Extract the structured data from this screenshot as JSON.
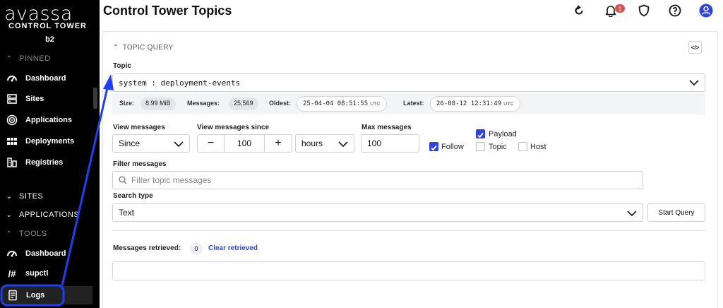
{
  "sidebar": {
    "logo": "avassa",
    "subtitle": "CONTROL TOWER",
    "instance": "b2",
    "pinned_label": "PINNED",
    "pinned_items": [
      {
        "label": "Dashboard",
        "icon": "dashboard-icon"
      },
      {
        "label": "Sites",
        "icon": "server-icon"
      },
      {
        "label": "Applications",
        "icon": "applications-icon"
      },
      {
        "label": "Deployments",
        "icon": "deployments-icon"
      },
      {
        "label": "Registries",
        "icon": "registries-icon"
      }
    ],
    "sections": {
      "sites": "SITES",
      "applications": "APPLICATIONS",
      "tools": "TOOLS"
    },
    "tool_items": [
      {
        "label": "Dashboard",
        "icon": "dashboard-icon"
      },
      {
        "label": "supctl",
        "icon": "terminal-icon"
      },
      {
        "label": "Logs",
        "icon": "logs-icon",
        "active": true
      }
    ]
  },
  "header": {
    "title": "Control Tower Topics",
    "notification_count": "1",
    "icons": [
      "refresh-icon",
      "bell-icon",
      "shield-icon",
      "help-icon",
      "user-icon"
    ]
  },
  "query": {
    "section_label": "TOPIC QUERY",
    "code_button": "</>",
    "topic_label": "Topic",
    "topic_value": "system : deployment-events",
    "stats": {
      "size_label": "Size:",
      "size_value": "8.99 MiB",
      "messages_label": "Messages:",
      "messages_value": "25,569",
      "oldest_label": "Oldest:",
      "oldest_value": "25-04-04 08:51:55",
      "oldest_tz": "UTC",
      "latest_label": "Latest:",
      "latest_value": "26-08-12 12:31:49",
      "latest_tz": "UTC"
    },
    "view_messages_label": "View messages",
    "view_messages_value": "Since",
    "since_label": "View messages since",
    "since_value": "100",
    "since_minus": "−",
    "since_plus": "+",
    "since_unit": "hours",
    "max_label": "Max messages",
    "max_value": "100",
    "follow_label": "Follow",
    "follow_checked": true,
    "payload_label": "Payload",
    "payload_checked": true,
    "topic_cb_label": "Topic",
    "host_label": "Host",
    "filter_label": "Filter messages",
    "filter_placeholder": "Filter topic messages",
    "search_type_label": "Search type",
    "search_type_value": "Text",
    "start_button": "Start Query",
    "retrieved_label": "Messages retrieved:",
    "retrieved_count": "0",
    "clear_label": "Clear retrieved"
  },
  "colors": {
    "accent": "#2f43d6",
    "annotation": "#1f3ff0",
    "sidebar": "#000000"
  }
}
